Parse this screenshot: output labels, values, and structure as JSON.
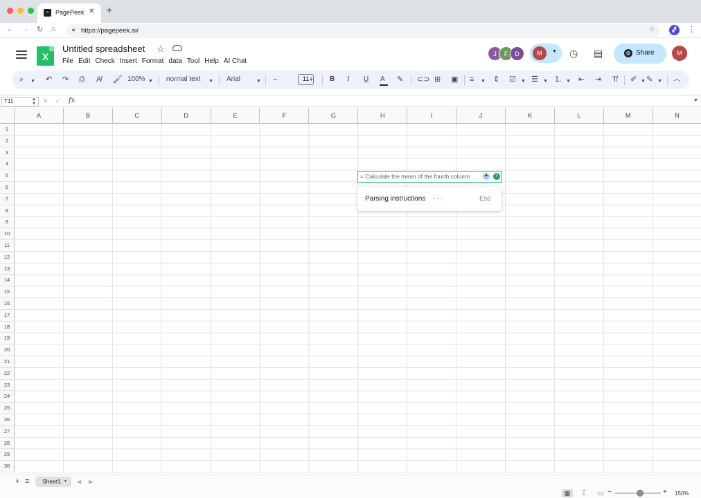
{
  "browser": {
    "tab_title": "PagePeek",
    "favicon_label": "∞",
    "url": "https://pagepeek.ai/"
  },
  "app": {
    "logo_letter": "X",
    "doc_title": "Untitled spreadsheet",
    "menu": [
      "File",
      "Edit",
      "Check",
      "Insert",
      "Format",
      "data",
      "Tool",
      "Help",
      "AI Chat"
    ],
    "collaborators": [
      {
        "initial": "J",
        "color": "#8e5a9e"
      },
      {
        "initial": "F",
        "color": "#6c9a5b"
      },
      {
        "initial": "D",
        "color": "#7a4f9a"
      }
    ],
    "current_user_initial": "M",
    "current_user_color": "#b84848",
    "share_label": "Share"
  },
  "toolbar": {
    "zoom": "100%",
    "text_style": "normal text",
    "font": "Arial",
    "font_size": "11"
  },
  "formula_bar": {
    "name_box": "T11",
    "fx_label": "fx"
  },
  "grid": {
    "columns": [
      "A",
      "B",
      "C",
      "D",
      "E",
      "F",
      "G",
      "H",
      "I",
      "J",
      "K",
      "L",
      "M",
      "N"
    ],
    "rows": [
      "1",
      "2",
      "3",
      "4",
      "5",
      "6",
      "7",
      "8",
      "9",
      "10",
      "11",
      "12",
      "13",
      "14",
      "15",
      "16",
      "17",
      "18",
      "19",
      "20",
      "21",
      "22",
      "23",
      "24",
      "25",
      "26",
      "27",
      "28",
      "29",
      "30"
    ],
    "active_cell_text": "= Calculate the mean of the fourth column",
    "accent_color": "#21c063"
  },
  "popup": {
    "status": "Parsing instructions",
    "dots": "···",
    "esc_label": "Esc"
  },
  "sheets": {
    "active": "Sheet1"
  },
  "status": {
    "zoom_percent": "150%",
    "zoom_level": 0.55
  }
}
